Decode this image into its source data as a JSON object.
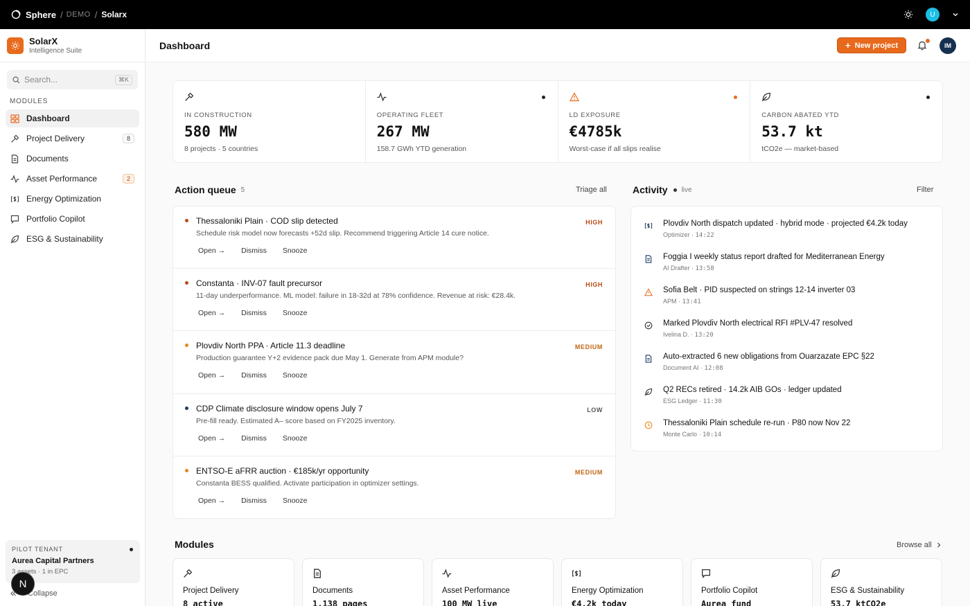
{
  "topbar": {
    "brand": "Sphere",
    "crumb1": "DEMO",
    "crumb2": "Solarx",
    "avatar": "U"
  },
  "sidebar": {
    "app_name": "SolarX",
    "app_sub": "Intelligence Suite",
    "search_placeholder": "Search...",
    "search_kbd": "⌘K",
    "section_label": "MODULES",
    "items": [
      {
        "label": "Dashboard",
        "icon": "grid-icon"
      },
      {
        "label": "Project Delivery",
        "icon": "hammer-icon",
        "badge": "8"
      },
      {
        "label": "Documents",
        "icon": "document-icon"
      },
      {
        "label": "Asset Performance",
        "icon": "pulse-icon",
        "badge": "2"
      },
      {
        "label": "Energy Optimization",
        "icon": "currency-icon"
      },
      {
        "label": "Portfolio Copilot",
        "icon": "chat-icon"
      },
      {
        "label": "ESG & Sustainability",
        "icon": "leaf-icon"
      }
    ],
    "tenant": {
      "label": "PILOT TENANT",
      "name": "Aurea Capital Partners",
      "meta": "3 assets · 1 in EPC"
    },
    "collapse": "Collapse",
    "n_badge": "N"
  },
  "header": {
    "title": "Dashboard",
    "new_project": "New project",
    "avatar": "IM"
  },
  "stats": [
    {
      "label": "IN CONSTRUCTION",
      "value": "580 MW",
      "sub": "8 projects · 5 countries",
      "icon": "hammer-icon"
    },
    {
      "label": "OPERATING FLEET",
      "value": "267 MW",
      "sub": "158.7 GWh YTD generation",
      "icon": "pulse-icon"
    },
    {
      "label": "LD EXPOSURE",
      "value": "€4785k",
      "sub": "Worst-case if all slips realise",
      "icon": "warning-icon"
    },
    {
      "label": "CARBON ABATED YTD",
      "value": "53.7 kt",
      "sub": "tCO2e — market-based",
      "icon": "leaf-icon"
    }
  ],
  "queue": {
    "title": "Action queue",
    "count": "5",
    "triage": "Triage all",
    "actions": {
      "open": "Open →",
      "dismiss": "Dismiss",
      "snooze": "Snooze"
    },
    "items": [
      {
        "title": "Thessaloniki Plain · COD slip detected",
        "desc": "Schedule risk model now forecasts +52d slip. Recommend triggering Article 14 cure notice.",
        "severity": "HIGH",
        "color": "#b84a14"
      },
      {
        "title": "Constanta · INV-07 fault precursor",
        "desc": "11-day underperformance. ML model: failure in 18-32d at 78% confidence. Revenue at risk: €28.4k.",
        "severity": "HIGH",
        "color": "#b84a14"
      },
      {
        "title": "Plovdiv North PPA · Article 11.3 deadline",
        "desc": "Production guarantee Y+2 evidence pack due May 1. Generate from APM module?",
        "severity": "MEDIUM",
        "color": "#e8861c"
      },
      {
        "title": "CDP Climate disclosure window opens July 7",
        "desc": "Pre-fill ready. Estimated A– score based on FY2025 inventory.",
        "severity": "LOW",
        "color": "#1e3a5f"
      },
      {
        "title": "ENTSO-E aFRR auction · €185k/yr opportunity",
        "desc": "Constanta BESS qualified. Activate participation in optimizer settings.",
        "severity": "MEDIUM",
        "color": "#e8861c"
      }
    ]
  },
  "activity": {
    "title": "Activity",
    "live": "live",
    "filter": "Filter",
    "items": [
      {
        "text": "Plovdiv North dispatch updated · hybrid mode · projected €4.2k today",
        "source": "Optimizer",
        "time": "14:22",
        "icon": "currency-icon"
      },
      {
        "text": "Foggia I weekly status report drafted for Mediterranean Energy",
        "source": "AI Drafter",
        "time": "13:58",
        "icon": "document-icon"
      },
      {
        "text": "Sofia Belt · PID suspected on strings 12-14 inverter 03",
        "source": "APM",
        "time": "13:41",
        "icon": "warning-icon"
      },
      {
        "text": "Marked Plovdiv North electrical RFI #PLV-47 resolved",
        "source": "Ivelina D.",
        "time": "13:20",
        "icon": "check-icon"
      },
      {
        "text": "Auto-extracted 6 new obligations from Ouarzazate EPC §22",
        "source": "Document AI",
        "time": "12:08",
        "icon": "document-icon"
      },
      {
        "text": "Q2 RECs retired · 14.2k AIB GOs · ledger updated",
        "source": "ESG Ledger",
        "time": "11:30",
        "icon": "leaf-icon"
      },
      {
        "text": "Thessaloniki Plain schedule re-run · P80 now Nov 22",
        "source": "Monte Carlo",
        "time": "10:14",
        "icon": "clock-icon"
      }
    ]
  },
  "modules": {
    "title": "Modules",
    "browse": "Browse all",
    "items": [
      {
        "label": "Project Delivery",
        "value": "8 active",
        "icon": "hammer-icon"
      },
      {
        "label": "Documents",
        "value": "1,138 pages",
        "icon": "document-icon"
      },
      {
        "label": "Asset Performance",
        "value": "100 MW live",
        "icon": "pulse-icon"
      },
      {
        "label": "Energy Optimization",
        "value": "€4.2k today",
        "icon": "currency-icon"
      },
      {
        "label": "Portfolio Copilot",
        "value": "Aurea fund",
        "icon": "chat-icon"
      },
      {
        "label": "ESG & Sustainability",
        "value": "53.7 ktCO2e",
        "icon": "leaf-icon"
      }
    ]
  },
  "colors": {
    "accent": "#e8691c",
    "high": "#b84a14",
    "medium": "#e8861c",
    "low": "#1e3a5f"
  }
}
